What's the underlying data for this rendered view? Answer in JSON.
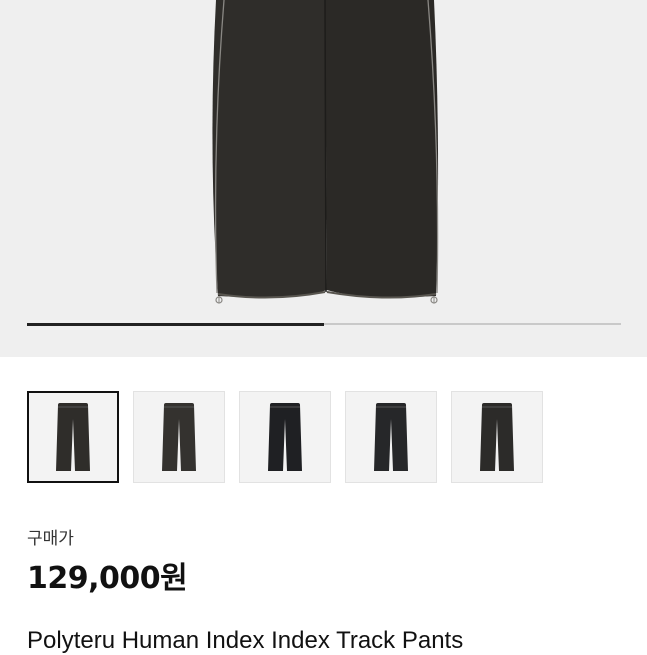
{
  "gallery": {
    "progress_fraction": 0.5,
    "thumbnails": [
      {
        "label": "pants-thumbnail-1",
        "color": "#2f2d2a",
        "selected": true
      },
      {
        "label": "pants-thumbnail-2",
        "color": "#34322f",
        "selected": false
      },
      {
        "label": "pants-thumbnail-3",
        "color": "#1f2023",
        "selected": false
      },
      {
        "label": "pants-thumbnail-4",
        "color": "#262729",
        "selected": false
      },
      {
        "label": "pants-thumbnail-5",
        "color": "#2c2b29",
        "selected": false
      }
    ]
  },
  "product": {
    "price_label": "구매가",
    "price": "129,000원",
    "title": "Polyteru Human Index Index Track Pants"
  },
  "colors": {
    "hero_background": "#efefef",
    "pants_main": "#2f2d2a",
    "accent_text": "#111111"
  }
}
